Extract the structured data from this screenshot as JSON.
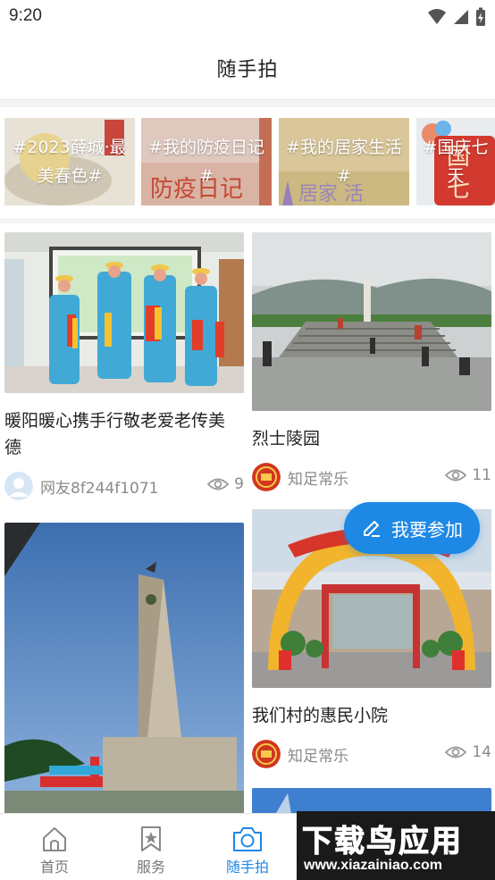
{
  "status_bar": {
    "time": "9:20"
  },
  "header": {
    "title": "随手拍"
  },
  "topics": [
    {
      "label": "#2023薛城·最美春色#"
    },
    {
      "label": "#我的防疫日记#"
    },
    {
      "label": "#我的居家生活#"
    },
    {
      "label": "#国庆七天"
    }
  ],
  "posts": [
    {
      "title": "暖阳暖心携手行敬老爱老传美德",
      "author": "网友8f244f1071",
      "views": "9"
    },
    {
      "title": "烈士陵园",
      "author": "知足常乐",
      "views": "11"
    },
    {
      "title": "我们村的惠民小院",
      "author": "知足常乐",
      "views": "14"
    }
  ],
  "join_button": {
    "label": "我要参加"
  },
  "tabs": [
    {
      "label": "首页",
      "icon": "home-icon"
    },
    {
      "label": "服务",
      "icon": "bookmark-star-icon"
    },
    {
      "label": "随手拍",
      "icon": "camera-icon",
      "active": true
    }
  ],
  "watermark": {
    "main": "下载鸟应用",
    "url": "www.xiazainiao.com"
  },
  "colors": {
    "accent": "#1e88e5",
    "text": "#222222",
    "muted": "#8a8a8a"
  }
}
